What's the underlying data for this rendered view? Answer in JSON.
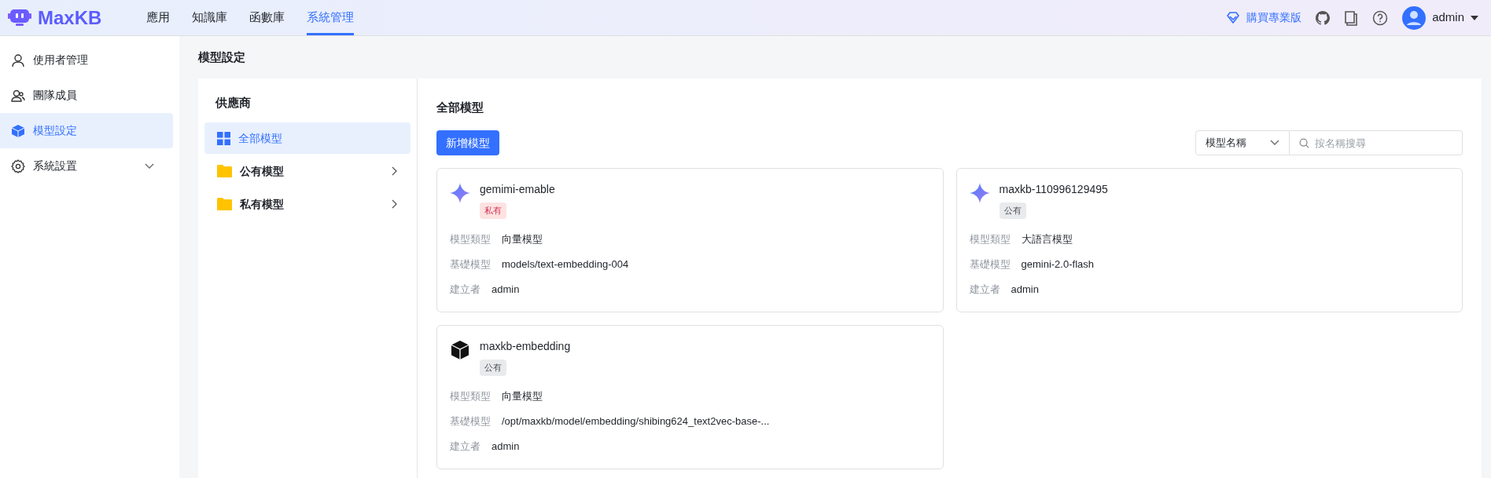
{
  "header": {
    "logo": "MaxKB",
    "nav": [
      {
        "label": "應用",
        "selected": false
      },
      {
        "label": "知識庫",
        "selected": false
      },
      {
        "label": "函數庫",
        "selected": false
      },
      {
        "label": "系統管理",
        "selected": true
      }
    ],
    "upgrade": "購買專業版",
    "user": "admin"
  },
  "sidebar": {
    "items": [
      {
        "label": "使用者管理",
        "kind": "user",
        "selected": false,
        "expandable": false
      },
      {
        "label": "團隊成員",
        "kind": "team",
        "selected": false,
        "expandable": false
      },
      {
        "label": "模型設定",
        "kind": "cube",
        "selected": true,
        "expandable": false
      },
      {
        "label": "系統設置",
        "kind": "gear",
        "selected": false,
        "expandable": true
      }
    ]
  },
  "page_title": "模型設定",
  "providers": {
    "title": "供應商",
    "items": [
      {
        "label": "全部模型",
        "kind": "grid",
        "selected": true,
        "expandable": false
      },
      {
        "label": "公有模型",
        "kind": "folder",
        "selected": false,
        "expandable": true
      },
      {
        "label": "私有模型",
        "kind": "folder",
        "selected": false,
        "expandable": true
      }
    ]
  },
  "models": {
    "title": "全部模型",
    "add_button": "新增模型",
    "filter": {
      "value": "模型名稱",
      "placeholder": "按名稱搜尋"
    },
    "cards": [
      {
        "name": "gemimi-emable",
        "kind": "sparkle",
        "tag": {
          "label": "私有",
          "kind": "private"
        },
        "fields": [
          {
            "label": "模型類型",
            "value": "向量模型"
          },
          {
            "label": "基礎模型",
            "value": "models/text-embedding-004"
          },
          {
            "label": "建立者",
            "value": "admin"
          }
        ]
      },
      {
        "name": "maxkb-110996129495",
        "kind": "sparkle",
        "tag": {
          "label": "公有",
          "kind": "public"
        },
        "fields": [
          {
            "label": "模型類型",
            "value": "大語言模型"
          },
          {
            "label": "基礎模型",
            "value": "gemini-2.0-flash"
          },
          {
            "label": "建立者",
            "value": "admin"
          }
        ]
      },
      {
        "name": "maxkb-embedding",
        "kind": "cube",
        "tag": {
          "label": "公有",
          "kind": "public"
        },
        "fields": [
          {
            "label": "模型類型",
            "value": "向量模型"
          },
          {
            "label": "基礎模型",
            "value": "/opt/maxkb/model/embedding/shibing624_text2vec-base-..."
          },
          {
            "label": "建立者",
            "value": "admin"
          }
        ]
      }
    ]
  }
}
